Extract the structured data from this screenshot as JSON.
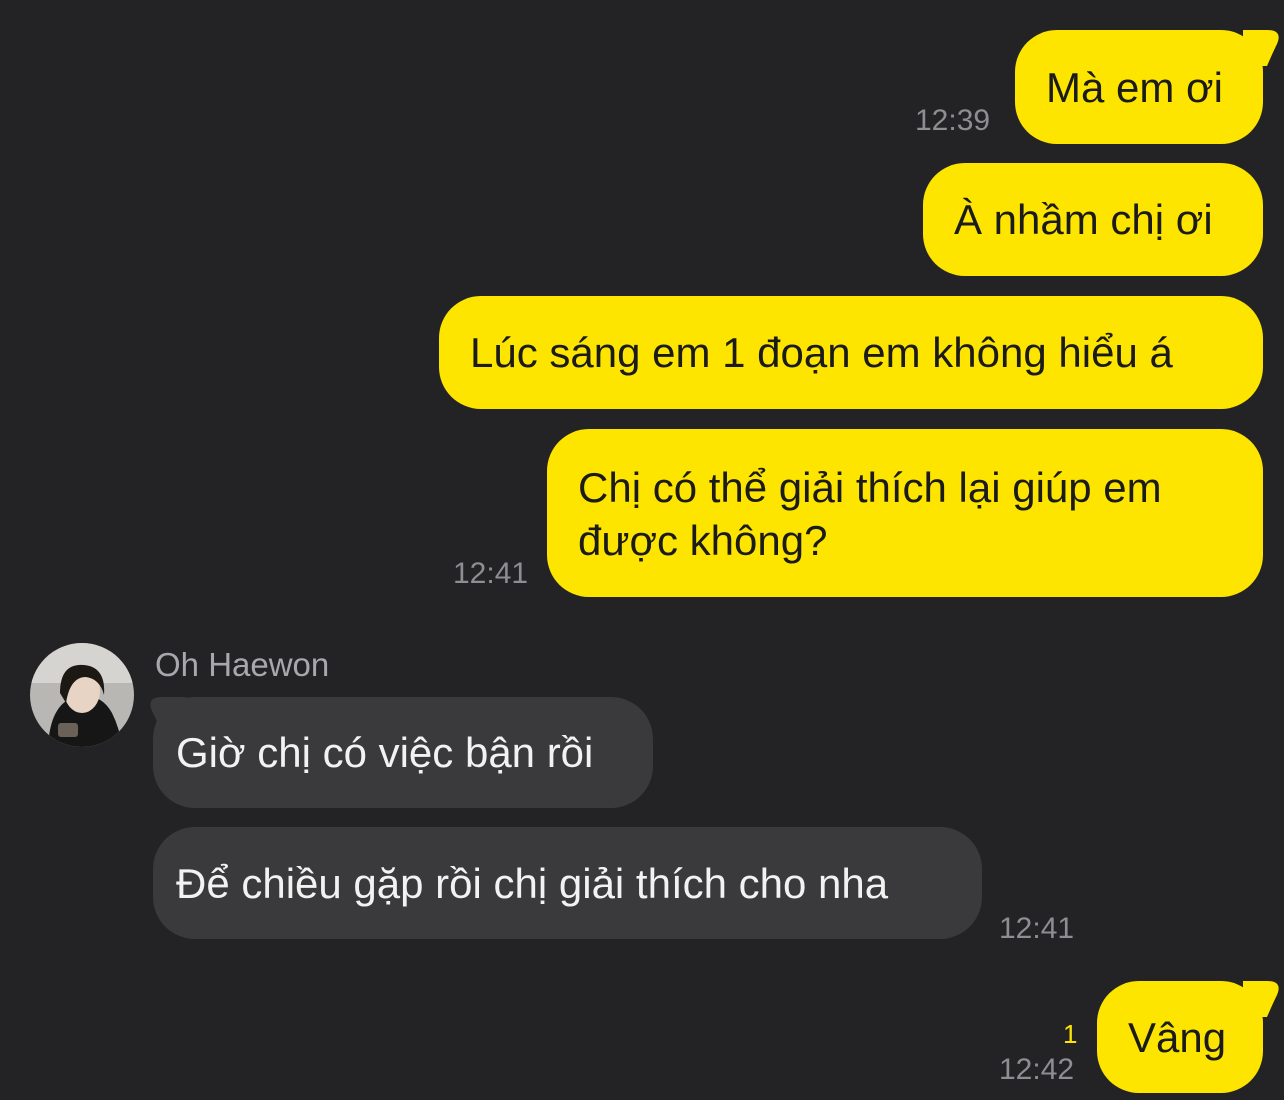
{
  "chat": {
    "contact_name": "Oh Haewon",
    "colors": {
      "background": "#232325",
      "outgoing_bubble": "#fee500",
      "incoming_bubble": "#3a3a3c",
      "timestamp": "#8e8e92",
      "unread": "#fee500"
    },
    "messages": [
      {
        "direction": "outgoing",
        "text": "Mà em ơi",
        "time": "12:39"
      },
      {
        "direction": "outgoing",
        "text": "À nhầm chị ơi"
      },
      {
        "direction": "outgoing",
        "text": "Lúc sáng em 1 đoạn em không hiểu á"
      },
      {
        "direction": "outgoing",
        "line1": "Chị có thể giải thích lại giúp em",
        "line2": "được không?",
        "time": "12:41"
      },
      {
        "direction": "incoming",
        "text": "Giờ chị có việc bận rồi"
      },
      {
        "direction": "incoming",
        "text": "Để chiều gặp rồi chị giải thích cho nha",
        "time": "12:41"
      },
      {
        "direction": "outgoing",
        "text": "Vâng",
        "time": "12:42",
        "unread_count": "1"
      }
    ]
  }
}
